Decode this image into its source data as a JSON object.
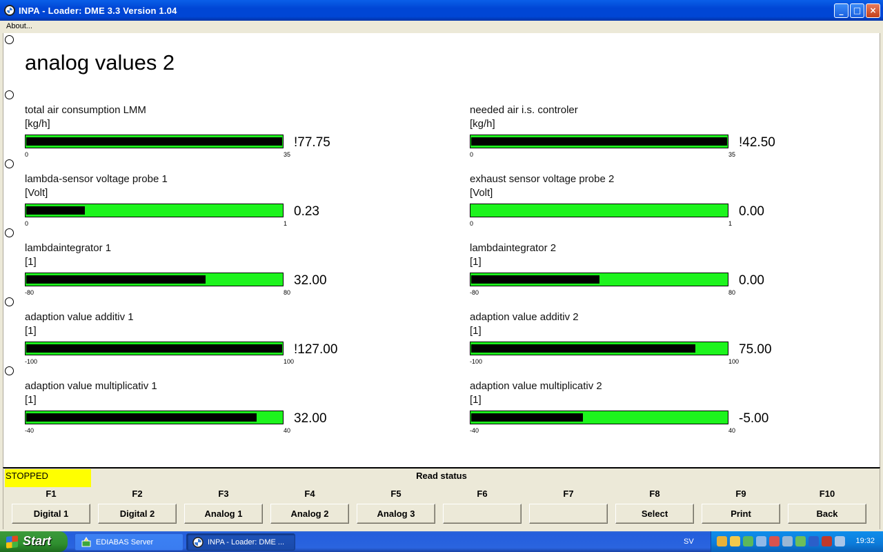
{
  "window": {
    "title": "INPA - Loader:  DME 3.3 Version 1.04",
    "minimize_glyph": "_",
    "maximize_glyph": "□",
    "close_glyph": "×"
  },
  "menu": {
    "about": "About..."
  },
  "page": {
    "title": "analog values 2"
  },
  "gauges_left": [
    {
      "label": "total air consumption LMM",
      "unit": "[kg/h]",
      "min": "0",
      "max": "35",
      "value": "!77.75",
      "fill_fraction": 1.0
    },
    {
      "label": "lambda-sensor voltage probe 1",
      "unit": "[Volt]",
      "min": "0",
      "max": "1",
      "value": "0.23",
      "fill_fraction": 0.23
    },
    {
      "label": "lambdaintegrator 1",
      "unit": "[1]",
      "min": "-80",
      "max": "80",
      "value": "32.00",
      "fill_fraction": 0.7
    },
    {
      "label": "adaption value additiv 1",
      "unit": "[1]",
      "min": "-100",
      "max": "100",
      "value": "!127.00",
      "fill_fraction": 1.0
    },
    {
      "label": "adaption value multiplicativ 1",
      "unit": "[1]",
      "min": "-40",
      "max": "40",
      "value": "32.00",
      "fill_fraction": 0.9
    }
  ],
  "gauges_right": [
    {
      "label": "needed air i.s. controler",
      "unit": "[kg/h]",
      "min": "0",
      "max": "35",
      "value": "!42.50",
      "fill_fraction": 1.0
    },
    {
      "label": "exhaust sensor voltage probe 2",
      "unit": "[Volt]",
      "min": "0",
      "max": "1",
      "value": "0.00",
      "fill_fraction": 0.0
    },
    {
      "label": "lambdaintegrator 2",
      "unit": "[1]",
      "min": "-80",
      "max": "80",
      "value": "0.00",
      "fill_fraction": 0.5
    },
    {
      "label": "adaption value additiv 2",
      "unit": "[1]",
      "min": "-100",
      "max": "100",
      "value": "75.00",
      "fill_fraction": 0.875
    },
    {
      "label": "adaption value multiplicativ 2",
      "unit": "[1]",
      "min": "-40",
      "max": "40",
      "value": "-5.00",
      "fill_fraction": 0.4375
    }
  ],
  "status": {
    "state": "STOPPED",
    "read_status": "Read status"
  },
  "fkeys": [
    {
      "key": "F1",
      "label": "Digital 1"
    },
    {
      "key": "F2",
      "label": "Digital 2"
    },
    {
      "key": "F3",
      "label": "Analog 1"
    },
    {
      "key": "F4",
      "label": "Analog 2"
    },
    {
      "key": "F5",
      "label": "Analog 3"
    },
    {
      "key": "F6",
      "label": ""
    },
    {
      "key": "F7",
      "label": ""
    },
    {
      "key": "F8",
      "label": "Select"
    },
    {
      "key": "F9",
      "label": "Print"
    },
    {
      "key": "F10",
      "label": "Back"
    }
  ],
  "taskbar": {
    "start": "Start",
    "tasks": [
      {
        "label": "EDIABAS Server",
        "icon": "ediabas-icon",
        "active": false
      },
      {
        "label": "INPA - Loader:  DME ...",
        "icon": "bmw-icon",
        "active": true
      }
    ],
    "language": "SV",
    "clock": "19:32"
  },
  "colors": {
    "gauge_bg": "#1DF41D",
    "gauge_fill": "#000000",
    "status_bg": "#FFFF00",
    "titlebar": "#0046D5"
  }
}
